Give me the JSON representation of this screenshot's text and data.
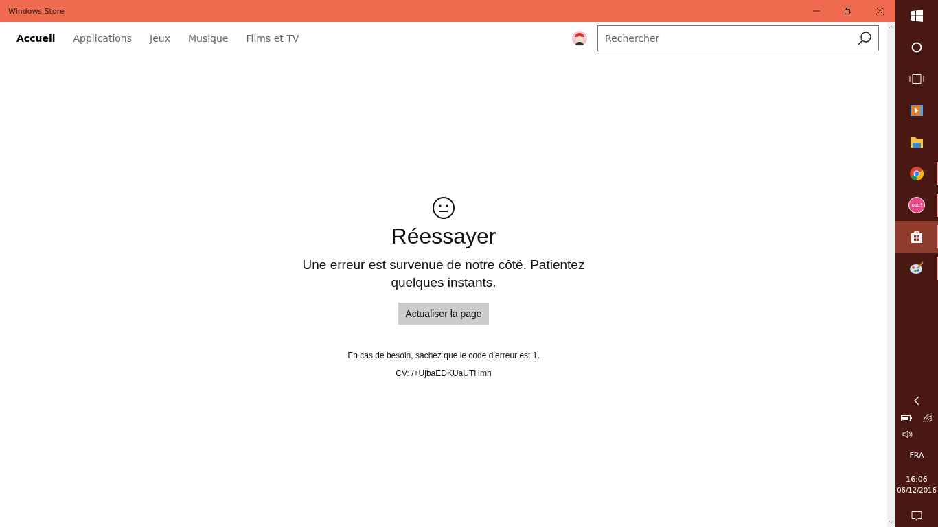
{
  "window": {
    "title": "Windows Store"
  },
  "nav": {
    "tabs": [
      {
        "label": "Accueil",
        "selected": true
      },
      {
        "label": "Applications",
        "selected": false
      },
      {
        "label": "Jeux",
        "selected": false
      },
      {
        "label": "Musique",
        "selected": false
      },
      {
        "label": "Films et TV",
        "selected": false
      }
    ]
  },
  "search": {
    "placeholder": "Rechercher"
  },
  "error": {
    "title": "Réessayer",
    "message": "Une erreur est survenue de notre côté. Patientez quelques instants.",
    "button": "Actualiser la page",
    "code_note": "En cas de besoin, sachez que le code d’erreur est 1.",
    "cv": "CV: /+UjbaEDKUaUTHmn"
  },
  "taskbar": {
    "apps": [
      {
        "kind": "media",
        "running": false,
        "active": false
      },
      {
        "kind": "explorer",
        "running": false,
        "active": false
      },
      {
        "kind": "chrome",
        "running": true,
        "active": false
      },
      {
        "kind": "osu",
        "label": "osu!",
        "running": true,
        "active": false
      },
      {
        "kind": "store",
        "running": true,
        "active": true
      },
      {
        "kind": "paint",
        "running": true,
        "active": false
      }
    ],
    "language": "FRA",
    "time": "16:06",
    "date": "06/12/2016"
  }
}
